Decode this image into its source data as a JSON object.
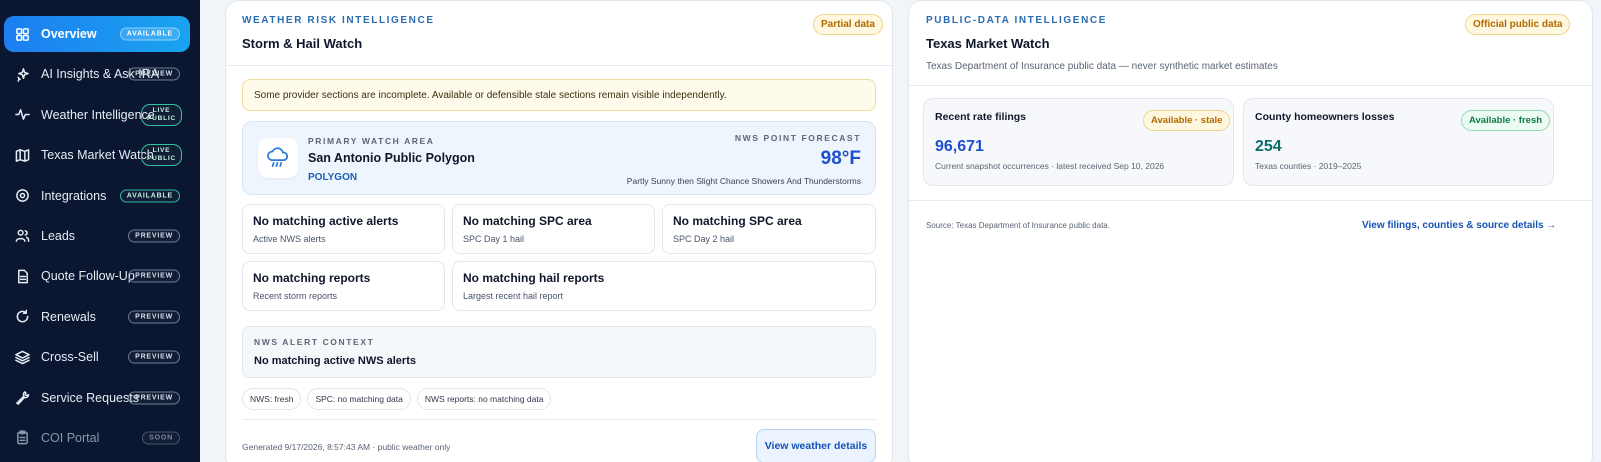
{
  "sidebar": {
    "items": [
      {
        "label": "Overview",
        "badge": "AVAILABLE"
      },
      {
        "label": "AI Insights & Ask IRA",
        "badge": "PREVIEW"
      },
      {
        "label": "Weather Intelligence",
        "badge_l1": "LIVE",
        "badge_l2": "PUBLIC"
      },
      {
        "label": "Texas Market Watch",
        "badge_l1": "LIVE",
        "badge_l2": "PUBLIC"
      },
      {
        "label": "Integrations",
        "badge": "AVAILABLE"
      },
      {
        "label": "Leads",
        "badge": "PREVIEW"
      },
      {
        "label": "Quote Follow-Up",
        "badge": "PREVIEW"
      },
      {
        "label": "Renewals",
        "badge": "PREVIEW"
      },
      {
        "label": "Cross-Sell",
        "badge": "PREVIEW"
      },
      {
        "label": "Service Requests",
        "badge": "PREVIEW"
      },
      {
        "label": "COI Portal",
        "badge": "SOON"
      }
    ]
  },
  "weather": {
    "eyebrow": "WEATHER RISK INTELLIGENCE",
    "title": "Storm & Hail Watch",
    "status_pill": "Partial data",
    "banner": "Some provider sections are incomplete. Available or defensible stale sections remain visible independently.",
    "watch": {
      "eyebrow": "PRIMARY WATCH AREA",
      "name": "San Antonio Public Polygon",
      "type": "POLYGON",
      "forecast_eyebrow": "NWS POINT FORECAST",
      "temp": "98°F",
      "forecast": "Partly Sunny then Slight Chance Showers And Thunderstorms"
    },
    "boxes": [
      {
        "title": "No matching active alerts",
        "sub": "Active NWS alerts"
      },
      {
        "title": "No matching SPC area",
        "sub": "SPC Day 1 hail"
      },
      {
        "title": "No matching SPC area",
        "sub": "SPC Day 2 hail"
      },
      {
        "title": "No matching reports",
        "sub": "Recent storm reports"
      },
      {
        "title": "No matching hail reports",
        "sub": "Largest recent hail report"
      }
    ],
    "context": {
      "eyebrow": "NWS ALERT CONTEXT",
      "text": "No matching active NWS alerts"
    },
    "chips": [
      "NWS: fresh",
      "SPC: no matching data",
      "NWS reports: no matching data"
    ],
    "generated": "Generated 9/17/2026, 8:57:43 AM · public weather only",
    "button": "View weather details"
  },
  "market": {
    "eyebrow": "PUBLIC-DATA INTELLIGENCE",
    "title": "Texas Market Watch",
    "subtitle": "Texas Department of Insurance public data — never synthetic market estimates",
    "status_pill": "Official public data",
    "stats": [
      {
        "title": "Recent rate filings",
        "pill": "Available · stale",
        "value": "96,671",
        "sub": "Current snapshot occurrences · latest received Sep 10, 2026"
      },
      {
        "title": "County homeowners losses",
        "pill": "Available · fresh",
        "value": "254",
        "sub": "Texas counties · 2019–2025"
      }
    ],
    "source": "Source: Texas Department of Insurance public data.",
    "link": "View filings, counties & source details →"
  },
  "colors": {
    "sidebar_bg": "#0b1730",
    "accent": "#1d7ef0",
    "link": "#1554b8",
    "warn": "#b06a00",
    "ok": "#0f7a48"
  }
}
